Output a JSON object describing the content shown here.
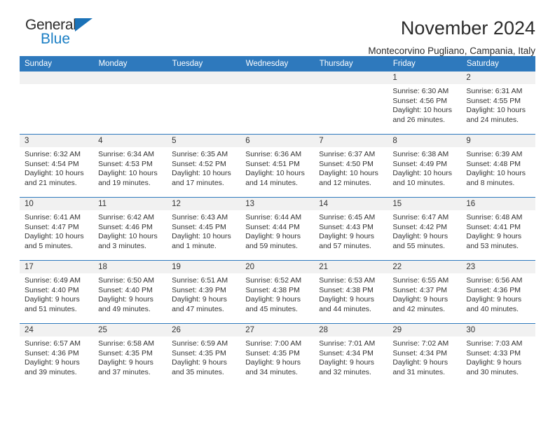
{
  "brand": {
    "name_top": "General",
    "name_bottom": "Blue",
    "accent_color": "#1a7ec4",
    "triangle_color": "#1b72b8"
  },
  "header": {
    "title": "November 2024",
    "subtitle": "Montecorvino Pugliano, Campania, Italy"
  },
  "calendar": {
    "header_bg": "#2e79bd",
    "daynum_bg": "#f1f1f1",
    "weekdays": [
      "Sunday",
      "Monday",
      "Tuesday",
      "Wednesday",
      "Thursday",
      "Friday",
      "Saturday"
    ],
    "weeks": [
      [
        {
          "day": "",
          "empty": true
        },
        {
          "day": "",
          "empty": true
        },
        {
          "day": "",
          "empty": true
        },
        {
          "day": "",
          "empty": true
        },
        {
          "day": "",
          "empty": true
        },
        {
          "day": "1",
          "sunrise": "Sunrise: 6:30 AM",
          "sunset": "Sunset: 4:56 PM",
          "daylight": "Daylight: 10 hours and 26 minutes."
        },
        {
          "day": "2",
          "sunrise": "Sunrise: 6:31 AM",
          "sunset": "Sunset: 4:55 PM",
          "daylight": "Daylight: 10 hours and 24 minutes."
        }
      ],
      [
        {
          "day": "3",
          "sunrise": "Sunrise: 6:32 AM",
          "sunset": "Sunset: 4:54 PM",
          "daylight": "Daylight: 10 hours and 21 minutes."
        },
        {
          "day": "4",
          "sunrise": "Sunrise: 6:34 AM",
          "sunset": "Sunset: 4:53 PM",
          "daylight": "Daylight: 10 hours and 19 minutes."
        },
        {
          "day": "5",
          "sunrise": "Sunrise: 6:35 AM",
          "sunset": "Sunset: 4:52 PM",
          "daylight": "Daylight: 10 hours and 17 minutes."
        },
        {
          "day": "6",
          "sunrise": "Sunrise: 6:36 AM",
          "sunset": "Sunset: 4:51 PM",
          "daylight": "Daylight: 10 hours and 14 minutes."
        },
        {
          "day": "7",
          "sunrise": "Sunrise: 6:37 AM",
          "sunset": "Sunset: 4:50 PM",
          "daylight": "Daylight: 10 hours and 12 minutes."
        },
        {
          "day": "8",
          "sunrise": "Sunrise: 6:38 AM",
          "sunset": "Sunset: 4:49 PM",
          "daylight": "Daylight: 10 hours and 10 minutes."
        },
        {
          "day": "9",
          "sunrise": "Sunrise: 6:39 AM",
          "sunset": "Sunset: 4:48 PM",
          "daylight": "Daylight: 10 hours and 8 minutes."
        }
      ],
      [
        {
          "day": "10",
          "sunrise": "Sunrise: 6:41 AM",
          "sunset": "Sunset: 4:47 PM",
          "daylight": "Daylight: 10 hours and 5 minutes."
        },
        {
          "day": "11",
          "sunrise": "Sunrise: 6:42 AM",
          "sunset": "Sunset: 4:46 PM",
          "daylight": "Daylight: 10 hours and 3 minutes."
        },
        {
          "day": "12",
          "sunrise": "Sunrise: 6:43 AM",
          "sunset": "Sunset: 4:45 PM",
          "daylight": "Daylight: 10 hours and 1 minute."
        },
        {
          "day": "13",
          "sunrise": "Sunrise: 6:44 AM",
          "sunset": "Sunset: 4:44 PM",
          "daylight": "Daylight: 9 hours and 59 minutes."
        },
        {
          "day": "14",
          "sunrise": "Sunrise: 6:45 AM",
          "sunset": "Sunset: 4:43 PM",
          "daylight": "Daylight: 9 hours and 57 minutes."
        },
        {
          "day": "15",
          "sunrise": "Sunrise: 6:47 AM",
          "sunset": "Sunset: 4:42 PM",
          "daylight": "Daylight: 9 hours and 55 minutes."
        },
        {
          "day": "16",
          "sunrise": "Sunrise: 6:48 AM",
          "sunset": "Sunset: 4:41 PM",
          "daylight": "Daylight: 9 hours and 53 minutes."
        }
      ],
      [
        {
          "day": "17",
          "sunrise": "Sunrise: 6:49 AM",
          "sunset": "Sunset: 4:40 PM",
          "daylight": "Daylight: 9 hours and 51 minutes."
        },
        {
          "day": "18",
          "sunrise": "Sunrise: 6:50 AM",
          "sunset": "Sunset: 4:40 PM",
          "daylight": "Daylight: 9 hours and 49 minutes."
        },
        {
          "day": "19",
          "sunrise": "Sunrise: 6:51 AM",
          "sunset": "Sunset: 4:39 PM",
          "daylight": "Daylight: 9 hours and 47 minutes."
        },
        {
          "day": "20",
          "sunrise": "Sunrise: 6:52 AM",
          "sunset": "Sunset: 4:38 PM",
          "daylight": "Daylight: 9 hours and 45 minutes."
        },
        {
          "day": "21",
          "sunrise": "Sunrise: 6:53 AM",
          "sunset": "Sunset: 4:38 PM",
          "daylight": "Daylight: 9 hours and 44 minutes."
        },
        {
          "day": "22",
          "sunrise": "Sunrise: 6:55 AM",
          "sunset": "Sunset: 4:37 PM",
          "daylight": "Daylight: 9 hours and 42 minutes."
        },
        {
          "day": "23",
          "sunrise": "Sunrise: 6:56 AM",
          "sunset": "Sunset: 4:36 PM",
          "daylight": "Daylight: 9 hours and 40 minutes."
        }
      ],
      [
        {
          "day": "24",
          "sunrise": "Sunrise: 6:57 AM",
          "sunset": "Sunset: 4:36 PM",
          "daylight": "Daylight: 9 hours and 39 minutes."
        },
        {
          "day": "25",
          "sunrise": "Sunrise: 6:58 AM",
          "sunset": "Sunset: 4:35 PM",
          "daylight": "Daylight: 9 hours and 37 minutes."
        },
        {
          "day": "26",
          "sunrise": "Sunrise: 6:59 AM",
          "sunset": "Sunset: 4:35 PM",
          "daylight": "Daylight: 9 hours and 35 minutes."
        },
        {
          "day": "27",
          "sunrise": "Sunrise: 7:00 AM",
          "sunset": "Sunset: 4:35 PM",
          "daylight": "Daylight: 9 hours and 34 minutes."
        },
        {
          "day": "28",
          "sunrise": "Sunrise: 7:01 AM",
          "sunset": "Sunset: 4:34 PM",
          "daylight": "Daylight: 9 hours and 32 minutes."
        },
        {
          "day": "29",
          "sunrise": "Sunrise: 7:02 AM",
          "sunset": "Sunset: 4:34 PM",
          "daylight": "Daylight: 9 hours and 31 minutes."
        },
        {
          "day": "30",
          "sunrise": "Sunrise: 7:03 AM",
          "sunset": "Sunset: 4:33 PM",
          "daylight": "Daylight: 9 hours and 30 minutes."
        }
      ]
    ]
  }
}
